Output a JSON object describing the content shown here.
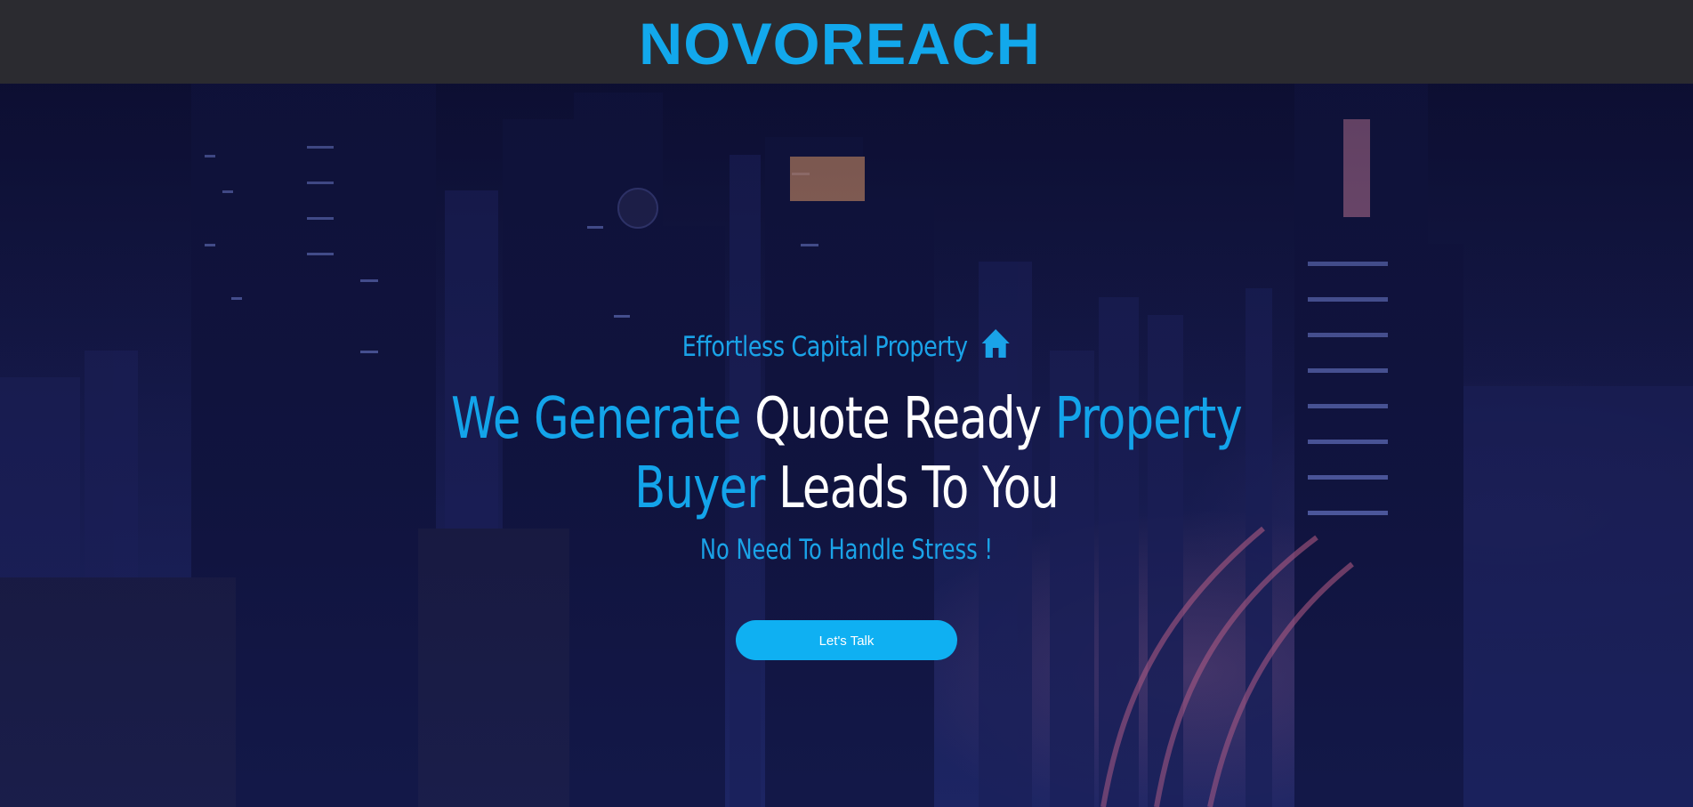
{
  "brand": {
    "logo_text": "NOVOREACH",
    "accent_color": "#12a8ec",
    "header_bg": "#2b2b30"
  },
  "hero": {
    "kicker": "Effortless Capital Property",
    "kicker_icon": "home-icon",
    "headline_line1": {
      "part1": "We Generate",
      "part2": "Quote Ready",
      "part3": "Property"
    },
    "headline_line2": {
      "part1": "Buyer",
      "part2": "Leads To You"
    },
    "subheadline": "No Need To Handle Stress !",
    "cta_label": "Let's Talk",
    "background": "night-city-skyline-photo"
  }
}
